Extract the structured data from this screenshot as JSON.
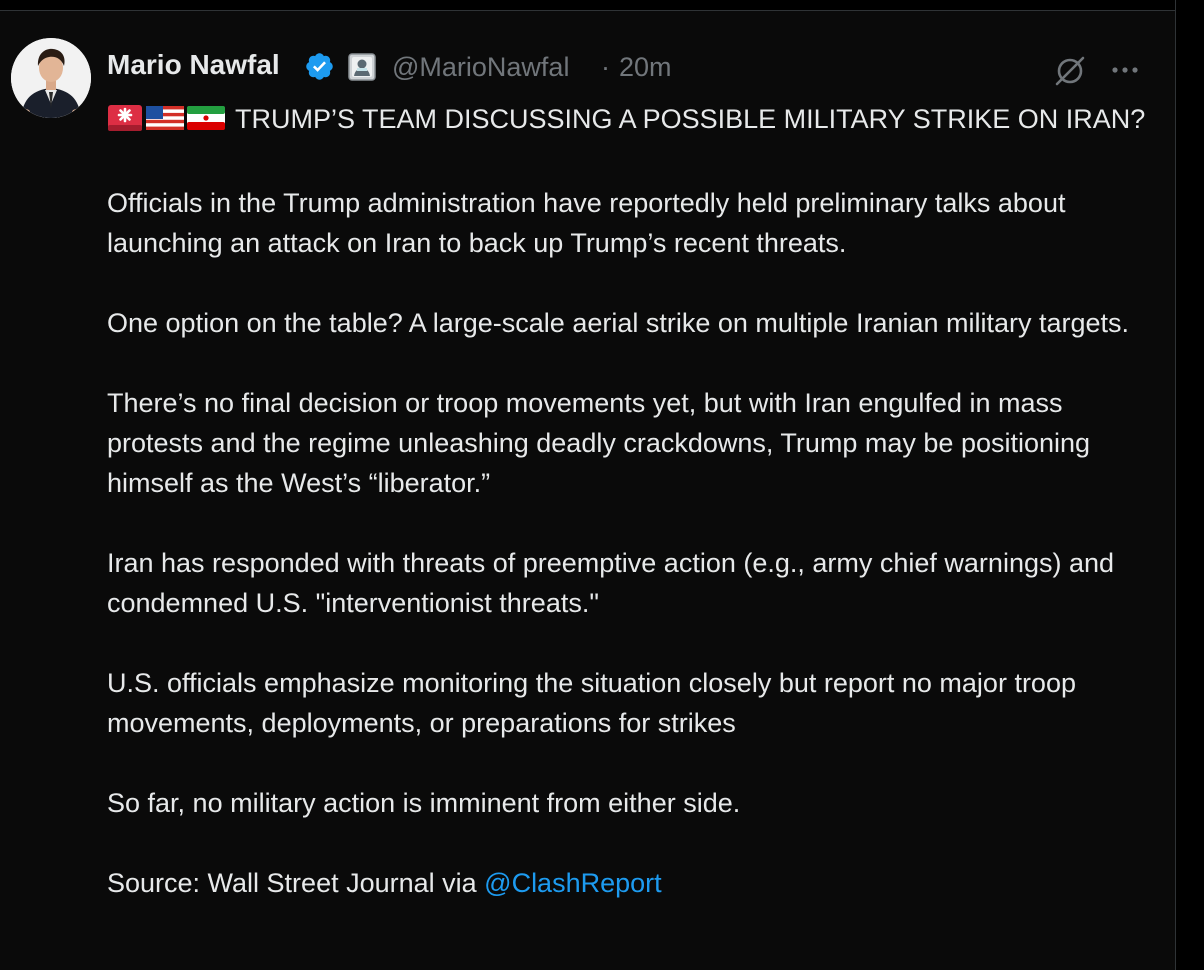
{
  "tweet": {
    "display_name": "Mario Nawfal",
    "handle": "@MarioNawfal",
    "separator": "·",
    "timestamp": "20m",
    "headline": "TRUMP’S TEAM DISCUSSING A POSSIBLE MILITARY STRIKE ON IRAN?",
    "paragraphs": [
      "Officials in the Trump administration have reportedly held preliminary talks about launching an attack on Iran to back up Trump’s recent threats.",
      "One option on the table? A large-scale aerial strike on multiple Iranian military targets.",
      "There’s no final decision or troop movements yet, but with Iran engulfed in mass protests and the regime unleashing deadly crackdowns, Trump may be positioning himself as the West’s “liberator.”",
      "Iran has responded with threats of preemptive action (e.g., army chief warnings) and condemned U.S. \"interventionist threats.\"",
      "U.S. officials emphasize monitoring the situation closely but report no major troop movements, deployments, or preparations for strikes",
      "So far, no military action is imminent from either side."
    ],
    "source_prefix": "Source: Wall Street Journal via ",
    "source_mention": "@ClashReport"
  },
  "icons": {
    "verified": "verified-badge-icon",
    "affiliate": "affiliate-badge-icon",
    "grok": "grok-icon",
    "more": "more-options-icon",
    "headline_emojis": [
      "rotating-light-emoji",
      "us-flag-emoji",
      "iran-flag-emoji"
    ]
  },
  "colors": {
    "background": "#0a0a0a",
    "text": "#e7e9ea",
    "secondary_text": "#71767b",
    "accent": "#1d9bf0",
    "divider": "#2f3336"
  }
}
